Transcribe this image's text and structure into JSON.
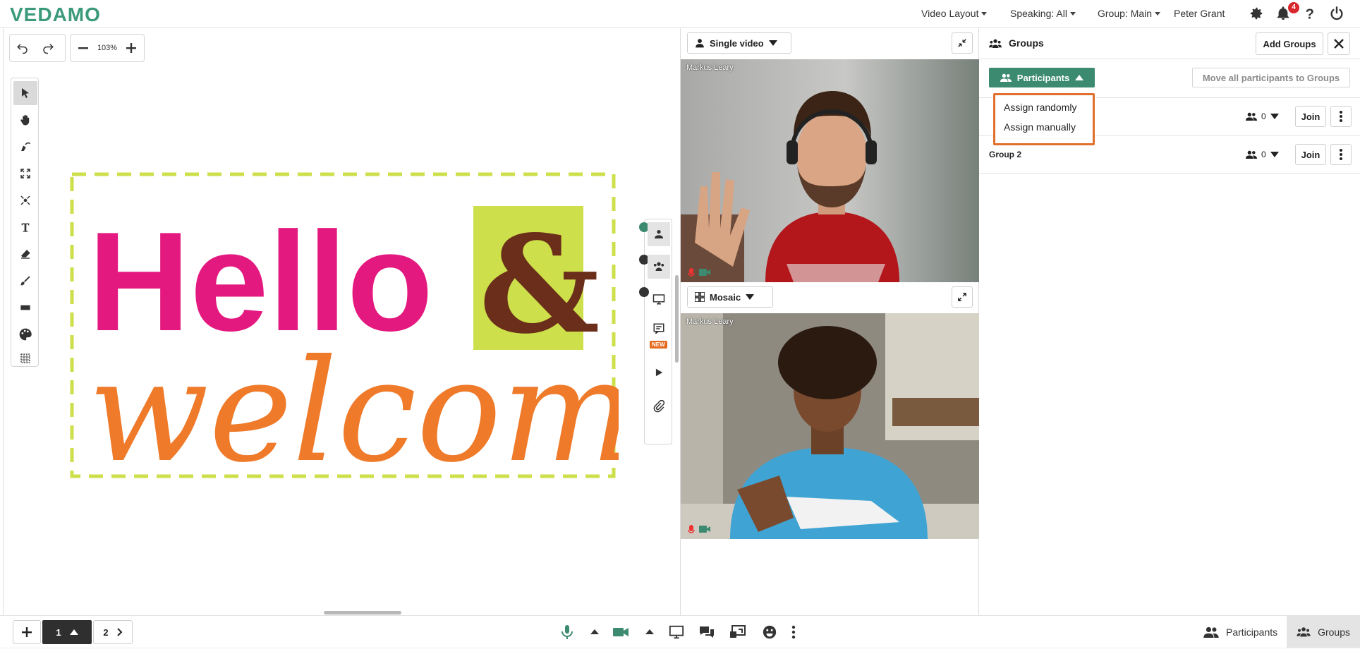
{
  "app": {
    "logo": "VEDAMO"
  },
  "topbar": {
    "video_layout": "Video Layout",
    "speaking": "Speaking: All",
    "group": "Group: Main",
    "user": "Peter Grant",
    "notification_count": "4"
  },
  "whiteboard": {
    "zoom": "103%",
    "image_text_line1": "Hello",
    "image_text_amp": "&",
    "image_text_line2": "welcome",
    "side_new_badge": "NEW"
  },
  "video": {
    "top_mode": "Single video",
    "bottom_mode": "Mosaic",
    "tile1_name": "Markus Leary",
    "tile2_name": "Markus Leary"
  },
  "groups_panel": {
    "title": "Groups",
    "add_button": "Add Groups",
    "participants_button": "Participants",
    "move_all_button": "Move all participants to Groups",
    "groups": [
      {
        "name": "",
        "count": "0",
        "join": "Join"
      },
      {
        "name": "Group 2",
        "count": "0",
        "join": "Join"
      }
    ],
    "dropdown": [
      "Assign randomly",
      "Assign manually"
    ]
  },
  "bottombar": {
    "page_current": "1",
    "page_next": "2",
    "tab_participants": "Participants",
    "tab_groups": "Groups"
  },
  "colors": {
    "brand": "#3a9a7b",
    "accent_green": "#3c8a6f",
    "highlight_orange": "#e0702b",
    "badge_red": "#d9262c",
    "hello_pink": "#e4197f",
    "welcome_orange": "#ee7a2a",
    "lime": "#cddf4a"
  }
}
